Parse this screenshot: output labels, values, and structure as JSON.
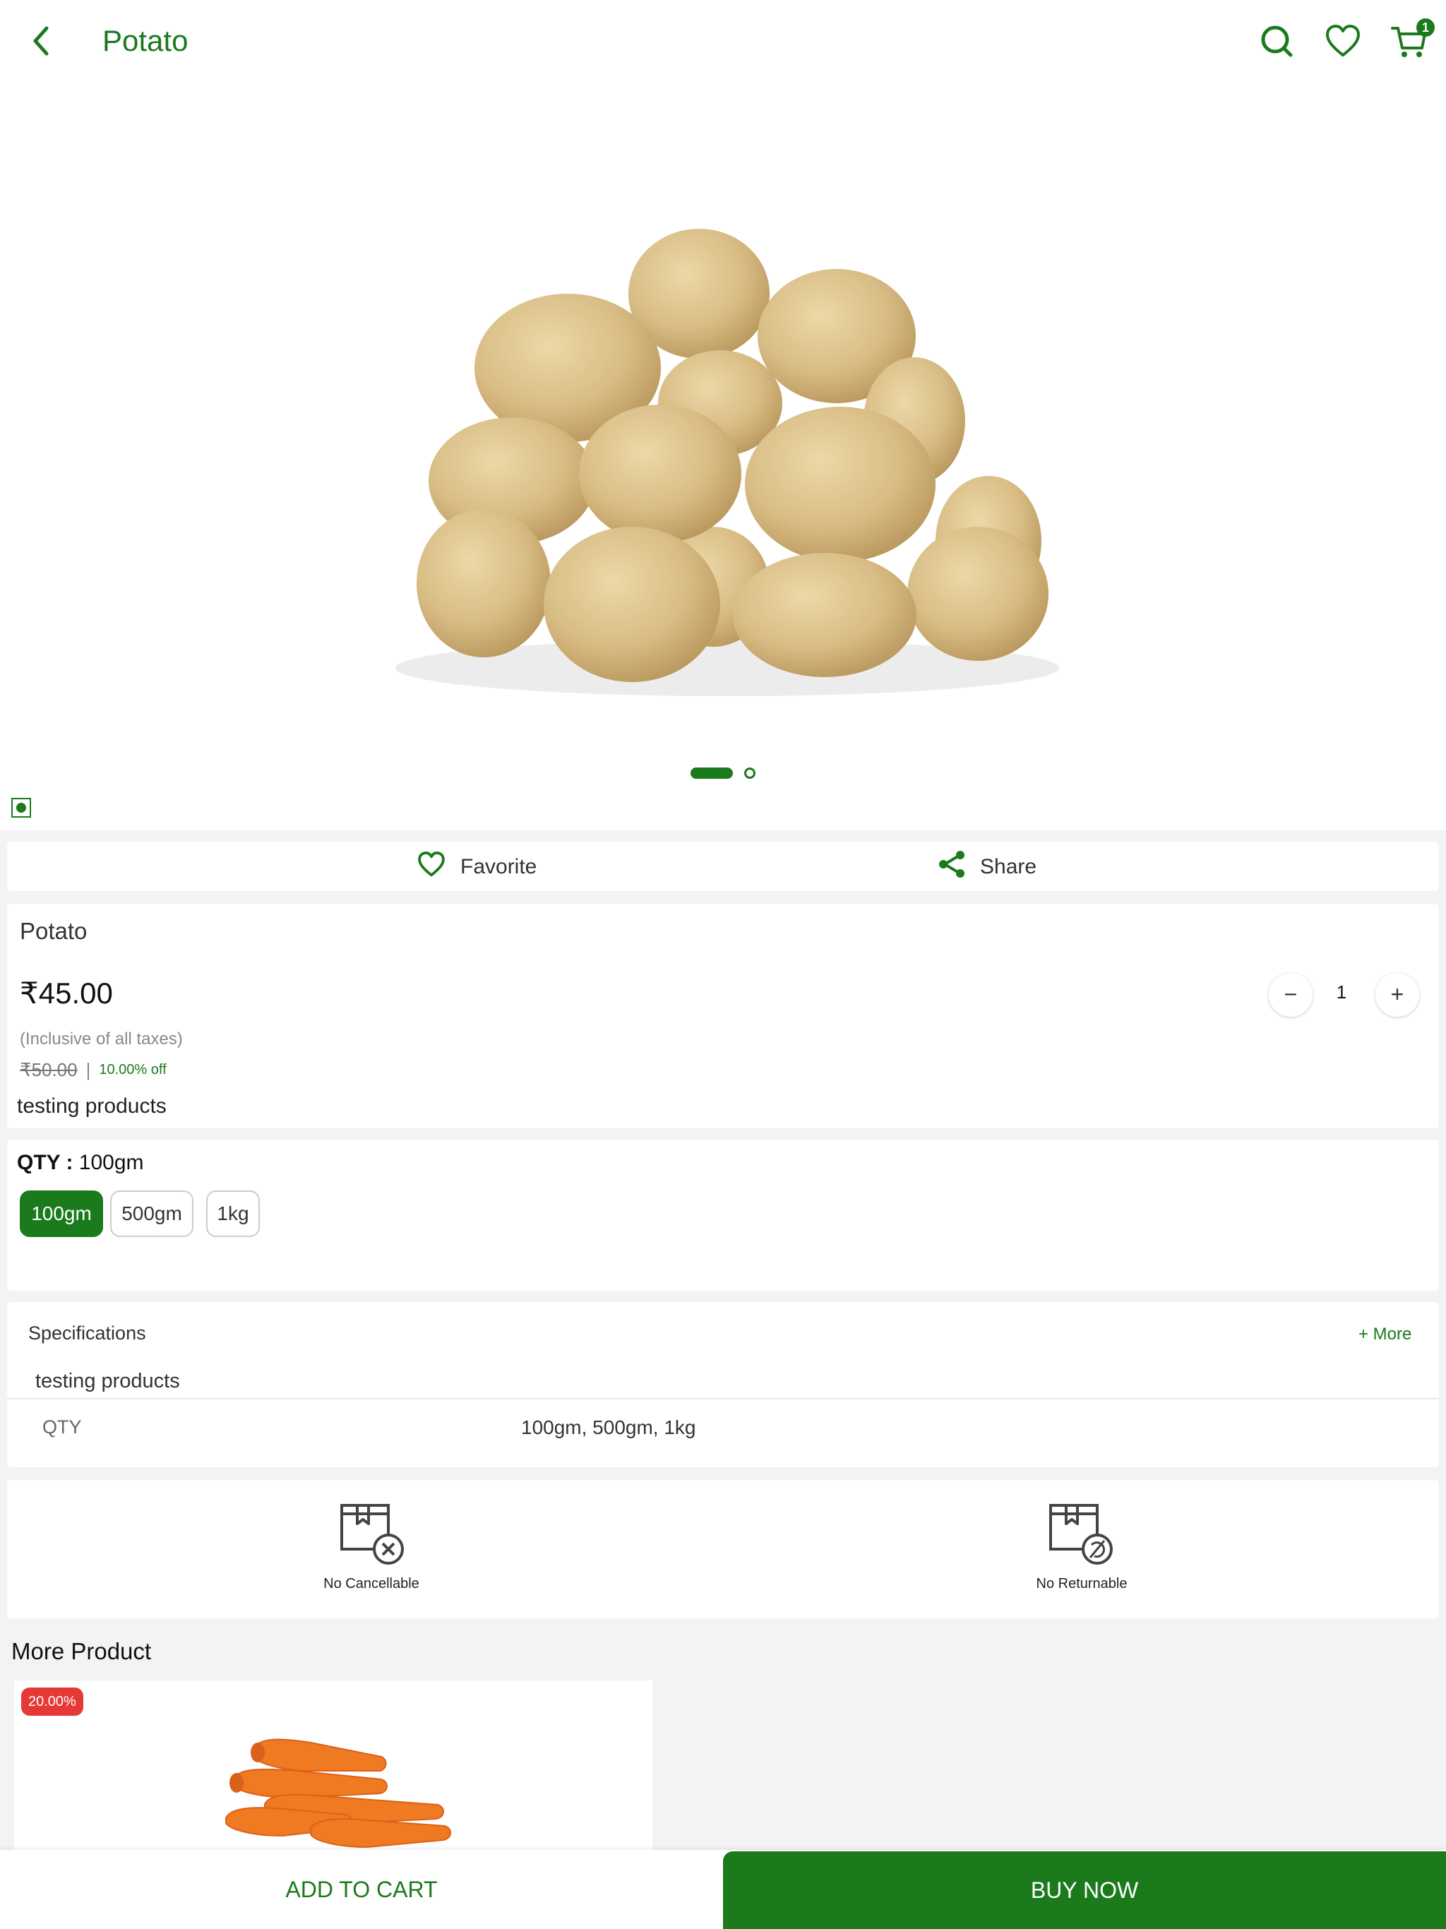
{
  "header": {
    "title": "Potato",
    "cart_count": "1"
  },
  "gallery": {
    "image_count": 2,
    "active_index": 0
  },
  "actions": {
    "favorite_label": "Favorite",
    "share_label": "Share"
  },
  "product": {
    "name": "Potato",
    "price": "₹45.00",
    "tax_note": "(Inclusive of all taxes)",
    "mrp": "₹50.00",
    "separator": "|",
    "discount": "10.00% off",
    "description": "testing products",
    "quantity": "1",
    "decrement_symbol": "−",
    "increment_symbol": "+"
  },
  "variants": {
    "label": "QTY :",
    "selected": "100gm",
    "options": [
      "100gm",
      "500gm",
      "1kg"
    ]
  },
  "specifications": {
    "title": "Specifications",
    "more_label": "+ More",
    "description": "testing products",
    "rows": [
      {
        "key": "QTY",
        "value": "100gm, 500gm, 1kg"
      }
    ]
  },
  "policies": [
    {
      "label": "No Cancellable",
      "icon": "no-cancel-icon"
    },
    {
      "label": "No Returnable",
      "icon": "no-return-icon"
    }
  ],
  "more_products": {
    "title": "More Product",
    "items": [
      {
        "badge": "20.00%",
        "image": "carrots"
      }
    ]
  },
  "bottom_bar": {
    "add_to_cart": "ADD TO CART",
    "buy_now": "BUY NOW"
  },
  "colors": {
    "brand_green": "#1b7a1b",
    "badge_red": "#e53935",
    "background": "#f3f3f3"
  }
}
